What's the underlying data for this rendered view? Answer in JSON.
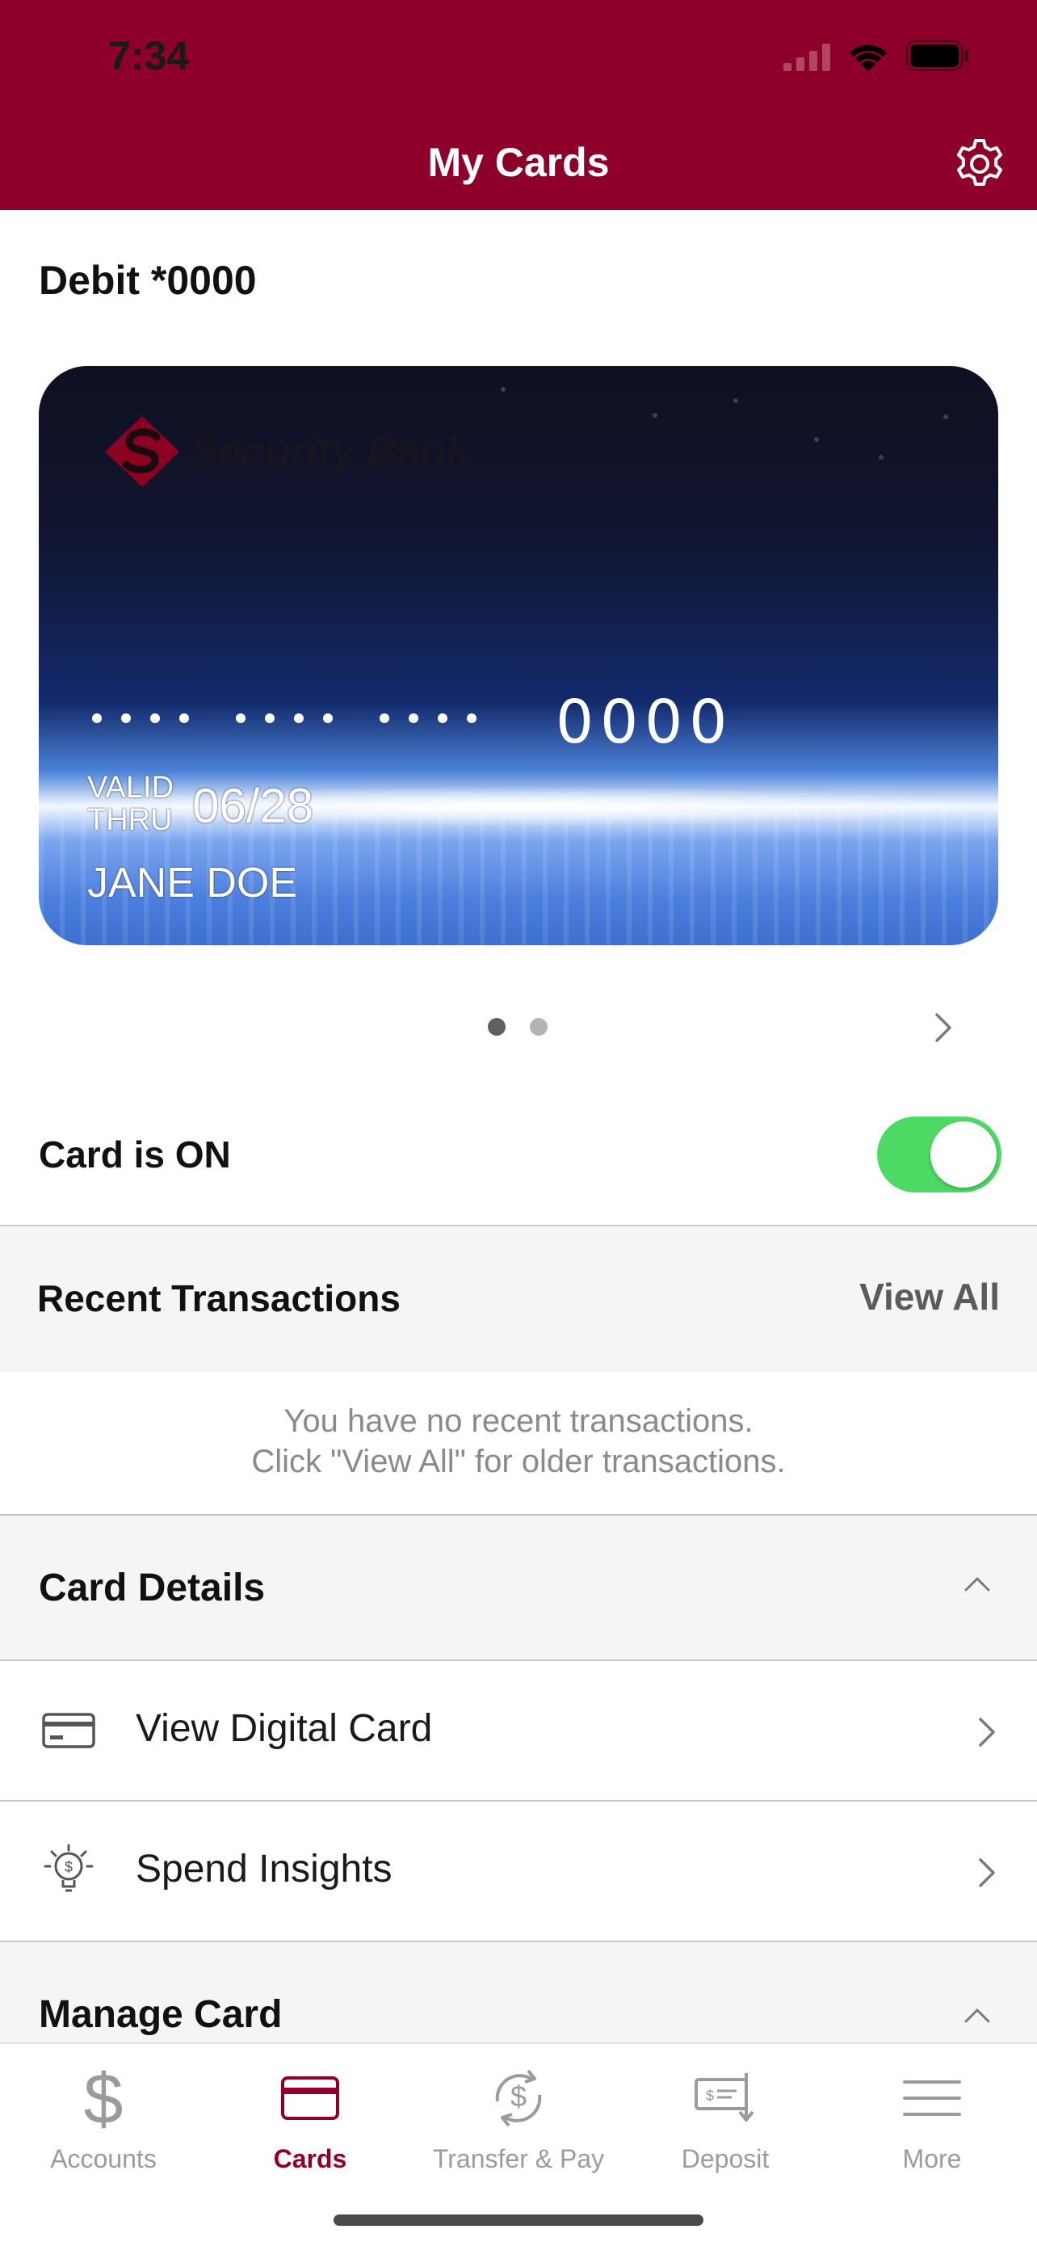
{
  "status_bar": {
    "time": "7:34"
  },
  "header": {
    "title": "My Cards"
  },
  "card": {
    "name": "Debit *0000",
    "bank_name": "Security Bank",
    "masked_groups": [
      "••••",
      "••••",
      "••••"
    ],
    "last4": "0000",
    "valid_thru_label": "VALID THRU",
    "expiry": "06/28",
    "holder": "JANE DOE"
  },
  "pager": {
    "count": 2,
    "active_index": 0
  },
  "card_status": {
    "label": "Card is ON",
    "on": true
  },
  "recent": {
    "title": "Recent Transactions",
    "view_all": "View All",
    "empty_line1": "You have no recent transactions.",
    "empty_line2": "Click \"View All\" for older transactions."
  },
  "card_details": {
    "title": "Card Details",
    "items": [
      {
        "label": "View Digital Card",
        "icon": "credit-card-icon"
      },
      {
        "label": "Spend Insights",
        "icon": "lightbulb-dollar-icon"
      }
    ]
  },
  "manage_card": {
    "title": "Manage Card"
  },
  "tabs": [
    {
      "label": "Accounts",
      "icon": "dollar-icon",
      "active": false
    },
    {
      "label": "Cards",
      "icon": "card-icon",
      "active": true
    },
    {
      "label": "Transfer & Pay",
      "icon": "transfer-icon",
      "active": false
    },
    {
      "label": "Deposit",
      "icon": "check-deposit-icon",
      "active": false
    },
    {
      "label": "More",
      "icon": "menu-icon",
      "active": false
    }
  ],
  "colors": {
    "brand": "#8c0029",
    "toggle_on": "#4cd964",
    "section_bg": "#f5f5f5",
    "inactive_tab": "#9b9b9b"
  }
}
